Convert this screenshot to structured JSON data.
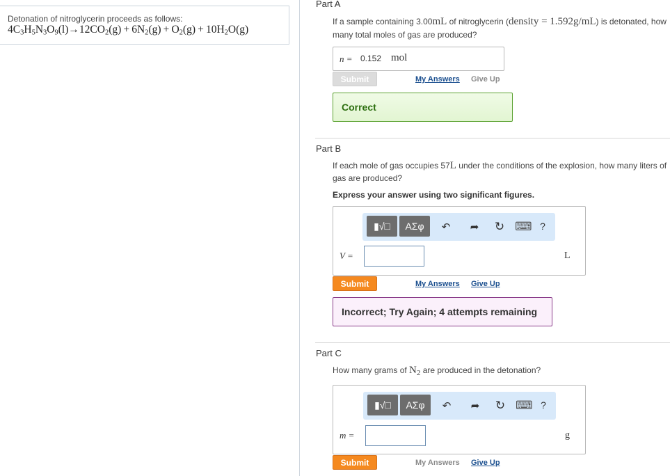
{
  "intro": {
    "text": "Detonation of nitroglycerin proceeds as follows:",
    "equation": {
      "p1": "4C",
      "s1": "3",
      "p2": "H",
      "s2": "5",
      "p3": "N",
      "s3": "3",
      "p4": "O",
      "s4": "9",
      "p5": "(l)→12CO",
      "s5": "2",
      "p6": "(g) + 6N",
      "s6": "2",
      "p7": "(g) + O",
      "s7": "2",
      "p8": "(g) + 10H",
      "s8": "2",
      "p9": "O(g)"
    }
  },
  "partA": {
    "title": "Part A",
    "q_line1_a": "If a sample containing 3.00",
    "q_line1_unit": "mL",
    "q_line1_b": " of nitroglycerin (",
    "q_line1_density": "density = 1.592g/mL",
    "q_line1_c": ") is detonated, how",
    "q_line2": "many total moles of gas are produced?",
    "answer": {
      "var": "n =",
      "value": "0.152",
      "unit": "mol"
    },
    "submit_label": "Submit",
    "my_answers": "My Answers",
    "give_up": "Give Up",
    "feedback": "Correct"
  },
  "partB": {
    "title": "Part B",
    "q_line1_a": "If each mole of gas occupies 57",
    "q_line1_unit": "L",
    "q_line1_b": " under the conditions of the explosion, how many liters of",
    "q_line2": "gas are produced?",
    "hint": "Express your answer using two significant figures.",
    "toolbar": {
      "templates": "▮√□",
      "greek": "ΑΣφ",
      "undo": "↶",
      "redo": "➦",
      "reset": "↻",
      "keyboard": "⌨",
      "help": "?"
    },
    "var": "V =",
    "unit": "L",
    "submit_label": "Submit",
    "my_answers": "My Answers",
    "give_up": "Give Up",
    "feedback": "Incorrect; Try Again; 4 attempts remaining"
  },
  "partC": {
    "title": "Part C",
    "q_a": "How many grams of ",
    "q_chem": "N",
    "q_sub": "2",
    "q_b": " are produced in the detonation?",
    "toolbar": {
      "templates": "▮√□",
      "greek": "ΑΣφ",
      "undo": "↶",
      "redo": "➦",
      "reset": "↻",
      "keyboard": "⌨",
      "help": "?"
    },
    "var": "m =",
    "unit": "g",
    "submit_label": "Submit",
    "my_answers": "My Answers",
    "give_up": "Give Up"
  },
  "colors": {
    "submit": "#f5891f",
    "correct_border": "#5aa12f",
    "incorrect_border": "#8a3d8a",
    "toolbar_bg": "#d8e9fa",
    "link": "#1b4f8f"
  }
}
